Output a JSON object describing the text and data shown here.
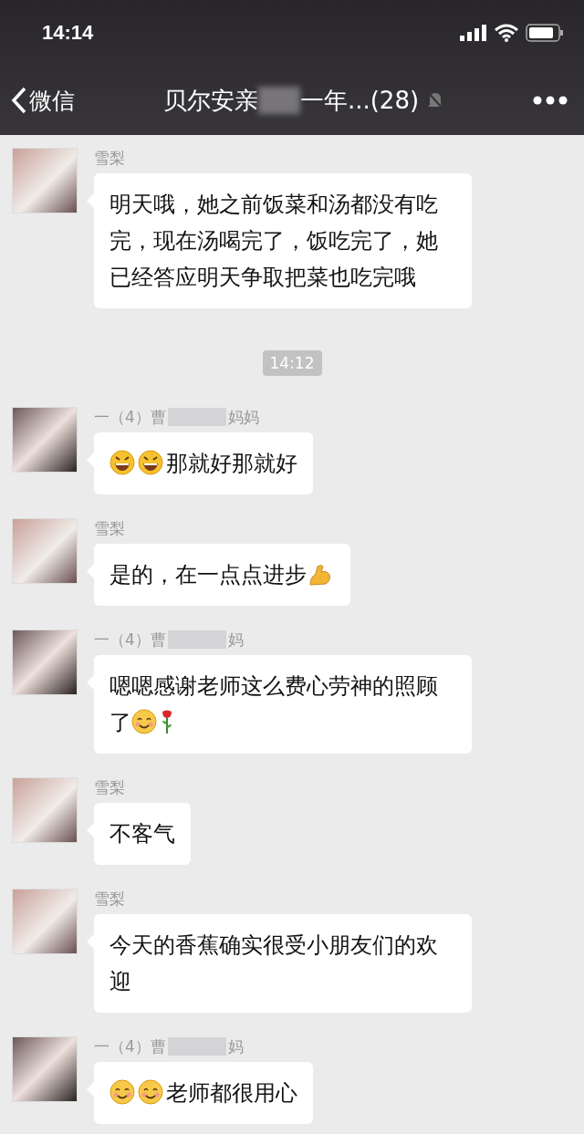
{
  "status_bar": {
    "time": "14:14"
  },
  "nav": {
    "back_label": "微信",
    "title_start": "贝尔安亲",
    "title_end": "一年...(28)",
    "muted": true
  },
  "items": [
    {
      "kind": "message",
      "sender": "雪梨",
      "redacted": false,
      "parts": [
        {
          "kind": "text",
          "text": "明天哦，她之前饭菜和汤都没有吃完，现在汤喝完了，饭吃完了，她已经答应明天争取把菜也吃完哦"
        }
      ]
    },
    {
      "kind": "time",
      "text": "14:12"
    },
    {
      "kind": "message",
      "sender": "一（4）曹",
      "sender_end": "妈妈",
      "redacted": true,
      "parts": [
        {
          "kind": "grin"
        },
        {
          "kind": "grin"
        },
        {
          "kind": "text",
          "text": "那就好那就好"
        }
      ]
    },
    {
      "kind": "message",
      "sender": "雪梨",
      "redacted": false,
      "parts": [
        {
          "kind": "text",
          "text": "是的，在一点点进步"
        },
        {
          "kind": "arm"
        }
      ]
    },
    {
      "kind": "message",
      "sender": "一（4）曹",
      "sender_end": "妈",
      "redacted": true,
      "parts": [
        {
          "kind": "text",
          "text": "嗯嗯感谢老师这么费心劳神的照顾了"
        },
        {
          "kind": "smile"
        },
        {
          "kind": "rose"
        }
      ]
    },
    {
      "kind": "message",
      "sender": "雪梨",
      "redacted": false,
      "parts": [
        {
          "kind": "text",
          "text": "不客气"
        }
      ]
    },
    {
      "kind": "message",
      "sender": "雪梨",
      "redacted": false,
      "parts": [
        {
          "kind": "text",
          "text": "今天的香蕉确实很受小朋友们的欢迎"
        }
      ]
    },
    {
      "kind": "message",
      "sender": "一（4）曹",
      "sender_end": "妈",
      "redacted": true,
      "parts": [
        {
          "kind": "smile"
        },
        {
          "kind": "smile"
        },
        {
          "kind": "text",
          "text": "老师都很用心"
        }
      ]
    }
  ]
}
